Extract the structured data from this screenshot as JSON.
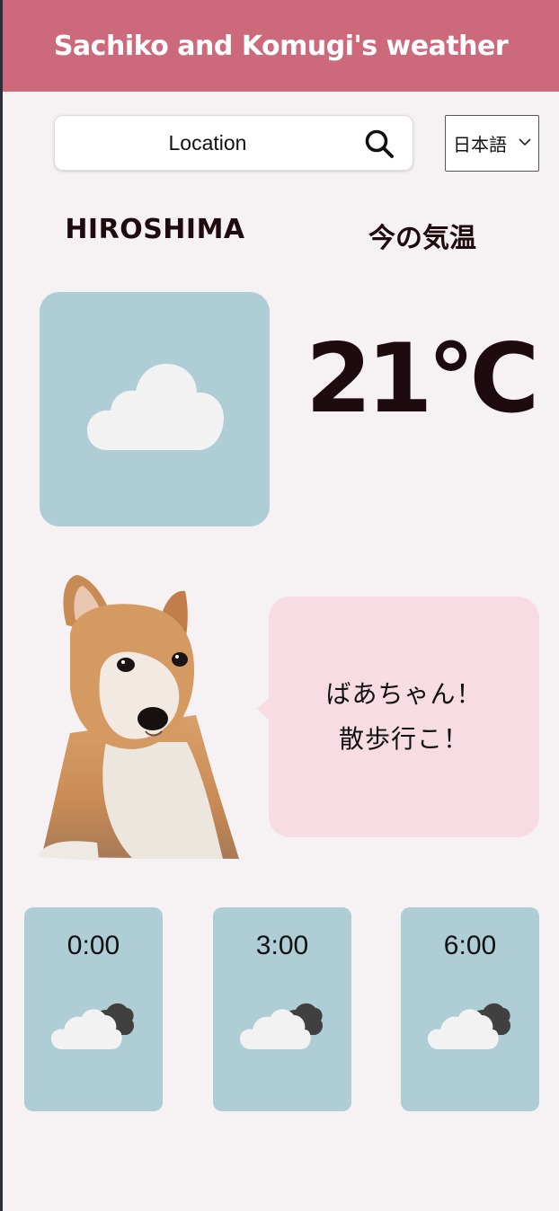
{
  "header": {
    "title": "Sachiko and Komugi's weather",
    "background": "#cc6a7c"
  },
  "search": {
    "placeholder": "Location",
    "icon": "search-icon"
  },
  "language": {
    "selected": "日本語"
  },
  "current": {
    "city": "HIROSHIMA",
    "label": "今の気温",
    "temperature": "21°C",
    "icon": "cloud-icon",
    "card_color": "#aecdd4"
  },
  "companion": {
    "image": "shiba-dog",
    "message": "ばあちゃん！\n散歩行こ！",
    "bubble_color": "#f7dce4"
  },
  "forecast": [
    {
      "time": "0:00",
      "icon": "cloudy-icon"
    },
    {
      "time": "3:00",
      "icon": "cloudy-icon"
    },
    {
      "time": "6:00",
      "icon": "cloudy-icon"
    }
  ]
}
